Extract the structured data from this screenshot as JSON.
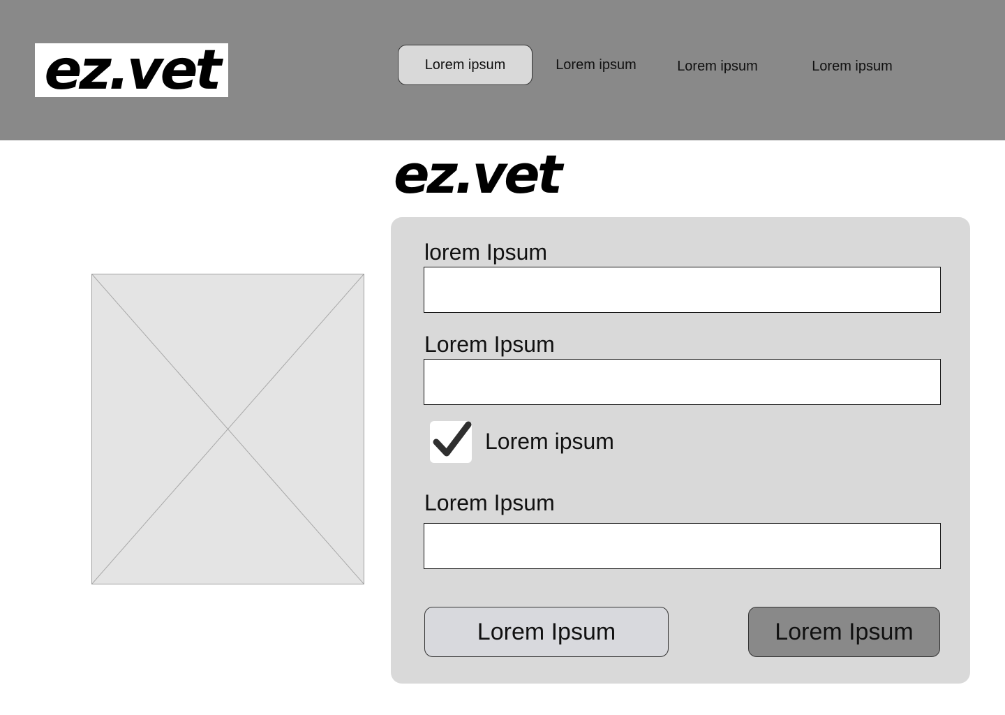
{
  "header": {
    "logo_text": "ez.vet",
    "nav": [
      {
        "label": "Lorem ipsum",
        "active": true
      },
      {
        "label": "Lorem ipsum",
        "active": false
      },
      {
        "label": "Lorem ipsum",
        "active": false
      },
      {
        "label": "Lorem ipsum",
        "active": false
      }
    ]
  },
  "main": {
    "logo_text": "ez.vet",
    "image_placeholder_icon": "image-placeholder-cross",
    "form": {
      "field1": {
        "label": "lorem Ipsum",
        "value": ""
      },
      "field2": {
        "label": "Lorem Ipsum",
        "value": ""
      },
      "checkbox": {
        "label": "Lorem ipsum",
        "checked": true,
        "icon": "checkmark-icon"
      },
      "field3": {
        "label": "Lorem Ipsum",
        "value": ""
      },
      "secondary_button": "Lorem Ipsum",
      "primary_button": "Lorem Ipsum"
    }
  },
  "colors": {
    "header_bg": "#898989",
    "panel_bg": "#d9d9d9",
    "placeholder_bg": "#e4e4e4",
    "secondary_button_bg": "#d8d9dd",
    "primary_button_bg": "#898989",
    "active_nav_bg": "#d9d9d9"
  }
}
